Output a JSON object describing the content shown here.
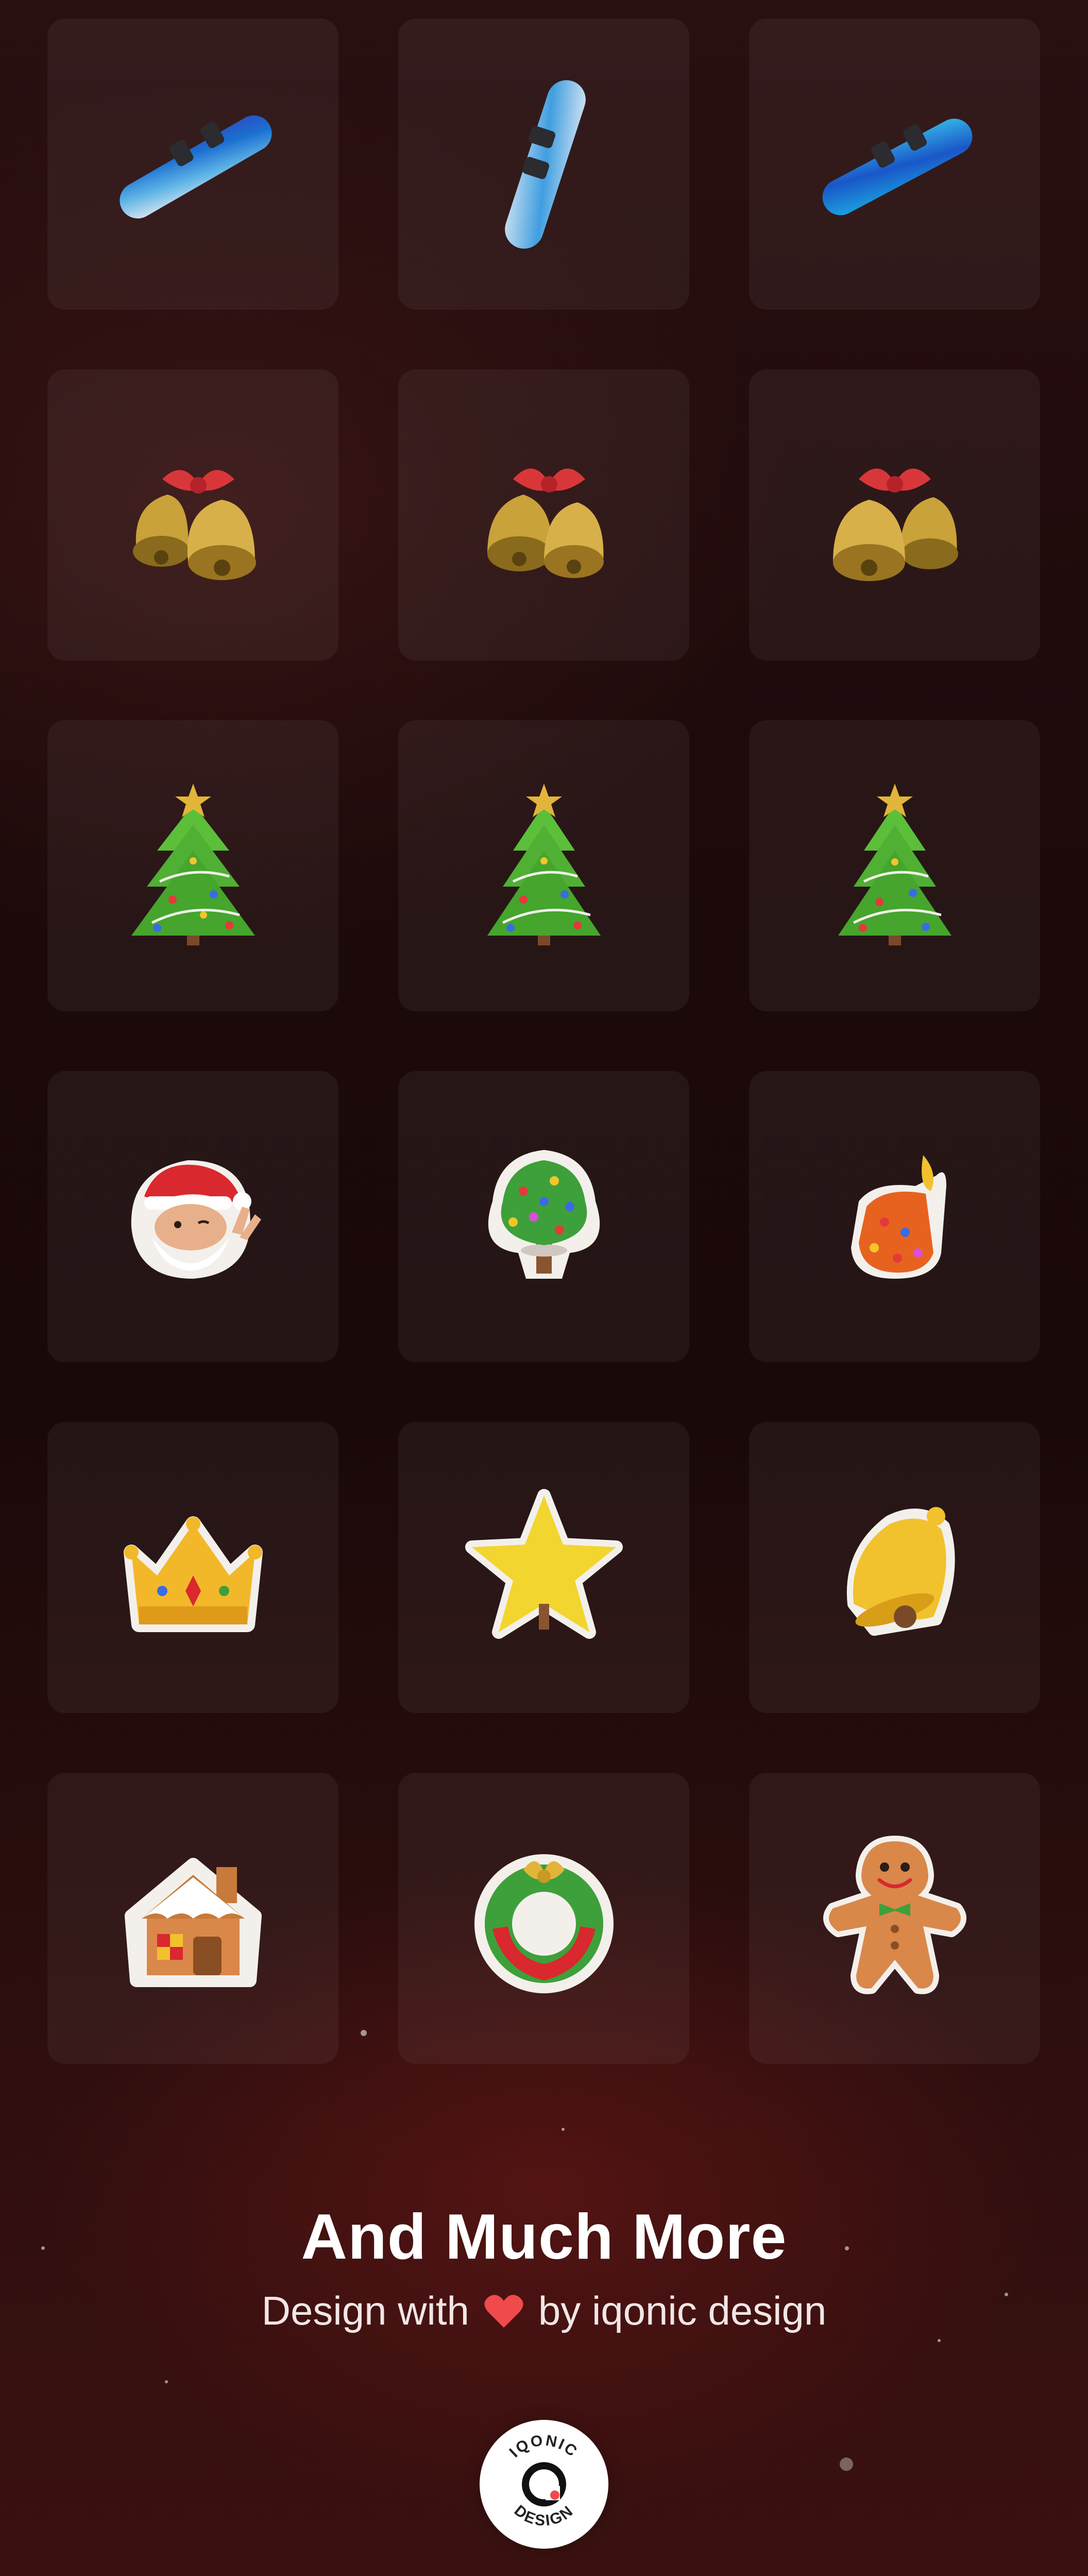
{
  "tiles": [
    {
      "icon": "snowboard-icon",
      "label": ""
    },
    {
      "icon": "snowboard-icon",
      "label": ""
    },
    {
      "icon": "snowboard-icon",
      "label": ""
    },
    {
      "icon": "jingle-bells-icon",
      "label": ""
    },
    {
      "icon": "jingle-bells-icon",
      "label": ""
    },
    {
      "icon": "jingle-bells-icon",
      "label": ""
    },
    {
      "icon": "christmas-tree-icon",
      "label": ""
    },
    {
      "icon": "christmas-tree-icon",
      "label": ""
    },
    {
      "icon": "christmas-tree-icon",
      "label": ""
    },
    {
      "icon": "santa-sticker-icon",
      "label": ""
    },
    {
      "icon": "tree-sticker-icon",
      "label": ""
    },
    {
      "icon": "candle-sticker-icon",
      "label": ""
    },
    {
      "icon": "crown-sticker-icon",
      "label": ""
    },
    {
      "icon": "star-sticker-icon",
      "label": ""
    },
    {
      "icon": "bell-sticker-icon",
      "label": ""
    },
    {
      "icon": "gingerbread-house-sticker-icon",
      "label": ""
    },
    {
      "icon": "wreath-sticker-icon",
      "label": ""
    },
    {
      "icon": "gingerbread-man-sticker-icon",
      "label": ""
    }
  ],
  "footer": {
    "title": "And Much More",
    "subtitle_before": "Design with",
    "subtitle_after": "by iqonic design",
    "heart_icon": "heart-icon",
    "logo_text_top": "IQONIC",
    "logo_text_bottom": "DESIGN"
  },
  "colors": {
    "background": "#1d0a0b",
    "tile": "#3a2020",
    "heart": "#ef4b4b",
    "text": "#ffffff"
  }
}
